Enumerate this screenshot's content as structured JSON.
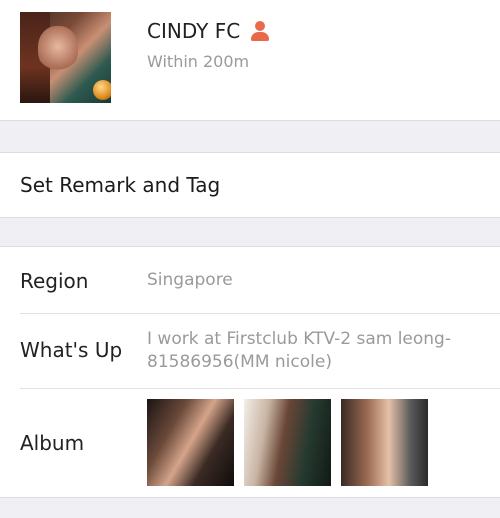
{
  "profile": {
    "name": "CINDY FC",
    "distance": "Within 200m",
    "gender_icon": "person-icon",
    "accent_color": "#e86a4a"
  },
  "remark": {
    "label": "Set Remark and Tag"
  },
  "info": {
    "region": {
      "label": "Region",
      "value": "Singapore"
    },
    "whats_up": {
      "label": "What's Up",
      "value": "I work at Firstclub KTV-2 sam leong-81586956(MM nicole)"
    },
    "album": {
      "label": "Album",
      "photo_count": 3
    }
  }
}
